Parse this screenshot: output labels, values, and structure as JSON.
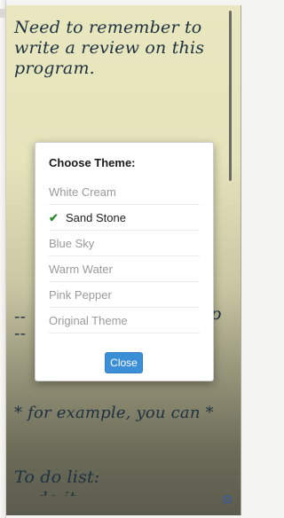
{
  "note": {
    "intro": "Need to remember to\nwrite a review on this\nprogram.",
    "dash_left": "--\n--",
    "dash_right": "p",
    "example": "* for example, you can *",
    "todo": "To do list:",
    "clipped": "  - do it"
  },
  "icons": {
    "settings": "gear-icon",
    "check": "check-icon"
  },
  "dialog": {
    "title": "Choose Theme:",
    "themes": [
      {
        "label": "White Cream",
        "selected": false
      },
      {
        "label": "Sand Stone",
        "selected": true
      },
      {
        "label": "Blue Sky",
        "selected": false
      },
      {
        "label": "Warm Water",
        "selected": false
      },
      {
        "label": "Pink Pepper",
        "selected": false
      },
      {
        "label": "Original Theme",
        "selected": false
      }
    ],
    "close_label": "Close"
  },
  "colors": {
    "accent": "#3a8fd6",
    "check": "#2e8b2e",
    "note_text": "#1d3140"
  }
}
